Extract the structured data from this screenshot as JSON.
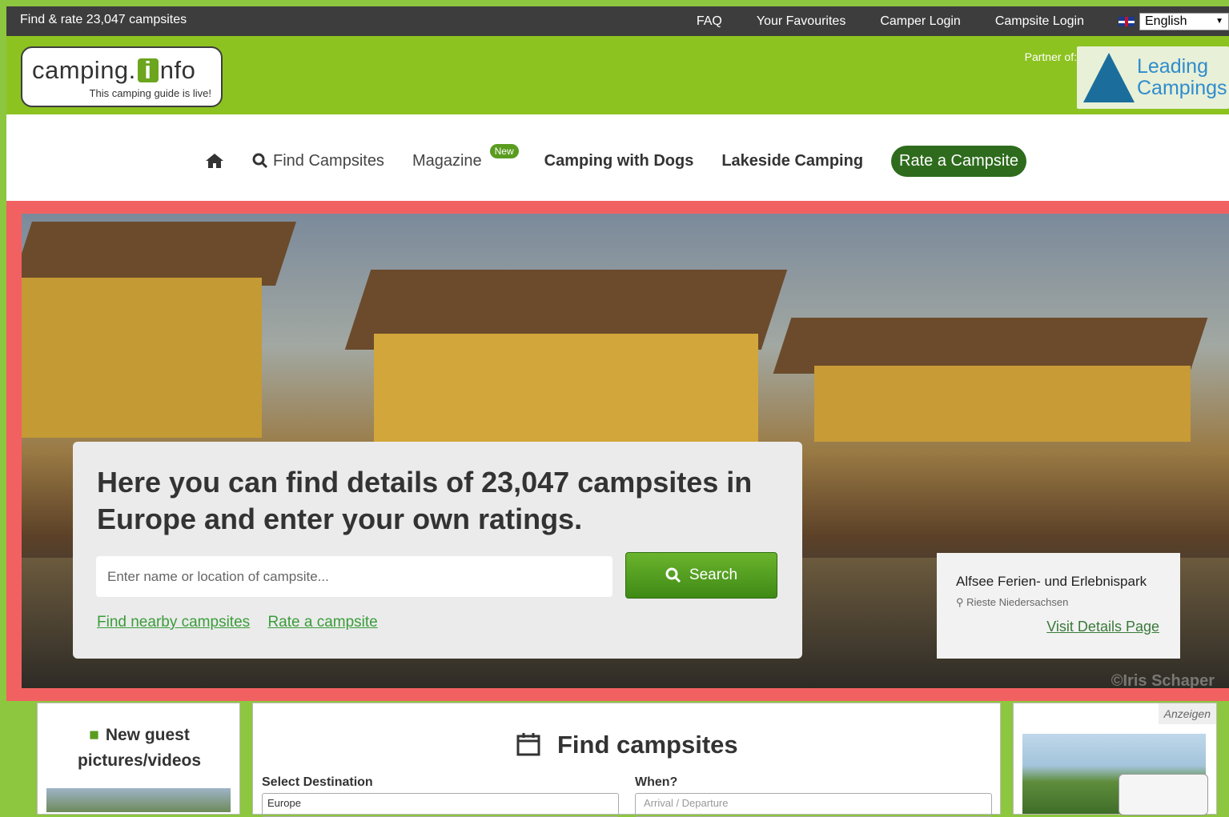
{
  "topbar": {
    "tagline": "Find & rate 23,047 campsites",
    "links": [
      "FAQ",
      "Your Favourites",
      "Camper Login",
      "Campsite Login"
    ],
    "language": "English"
  },
  "header": {
    "logo_word_left": "camping.",
    "logo_i": "i",
    "logo_word_right": "nfo",
    "logo_slogan": "This camping guide is live!",
    "partner_label": "Partner of:",
    "partner_name_line1": "Leading",
    "partner_name_line2": "Campings"
  },
  "nav": {
    "find": "Find Campsites",
    "magazine": "Magazine",
    "new_badge": "New",
    "dogs": "Camping with Dogs",
    "lakeside": "Lakeside Camping",
    "rate": "Rate a Campsite"
  },
  "hero": {
    "headline": "Here you can find details of 23,047 campsites in Europe and enter your own ratings.",
    "search_placeholder": "Enter name or location of campsite...",
    "search_button": "Search",
    "link_nearby": "Find nearby campsites",
    "link_rate": "Rate a campsite",
    "caption_name": "Alfsee Ferien- und Erlebnispark",
    "caption_location": "Rieste Niedersachsen",
    "caption_visit": "Visit Details Page",
    "photo_credit": "©Iris Schaper"
  },
  "panels": {
    "guest_title": "New guest pictures/videos",
    "find_title": "Find campsites",
    "select_destination": "Select Destination",
    "destination_value": "Europe",
    "when_label": "When?",
    "when_placeholder": "Arrival / Departure",
    "ad_label": "Anzeigen"
  }
}
